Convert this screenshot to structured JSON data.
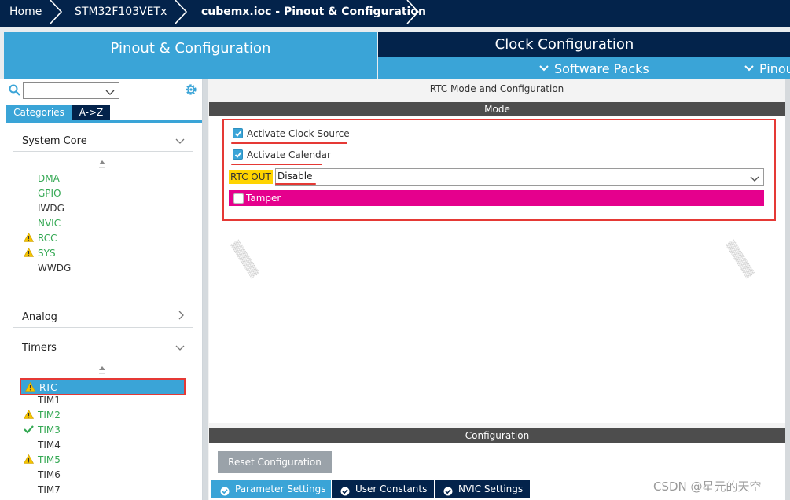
{
  "breadcrumb": {
    "items": [
      {
        "label": "Home"
      },
      {
        "label": "STM32F103VETx"
      },
      {
        "label": "cubemx.ioc - Pinout & Configuration"
      }
    ]
  },
  "main_tabs": {
    "pinout": "Pinout & Configuration",
    "clock": "Clock Configuration"
  },
  "sub_tabs": {
    "software_packs": "Software Packs",
    "pinout": "Pinout"
  },
  "sidebar": {
    "search": {
      "value": "",
      "placeholder": ""
    },
    "tabs": {
      "categories": "Categories",
      "az": "A->Z"
    },
    "groups": {
      "system_core": {
        "label": "System Core",
        "items": [
          {
            "label": "DMA",
            "status": "none",
            "configured": true
          },
          {
            "label": "GPIO",
            "status": "none",
            "configured": true
          },
          {
            "label": "IWDG",
            "status": "none",
            "configured": false
          },
          {
            "label": "NVIC",
            "status": "none",
            "configured": true
          },
          {
            "label": "RCC",
            "status": "warning",
            "configured": true
          },
          {
            "label": "SYS",
            "status": "warning",
            "configured": true
          },
          {
            "label": "WWDG",
            "status": "none",
            "configured": false
          }
        ]
      },
      "analog": {
        "label": "Analog"
      },
      "timers": {
        "label": "Timers",
        "items": [
          {
            "label": "RTC",
            "status": "warning",
            "selected": true
          },
          {
            "label": "TIM1",
            "status": "none",
            "configured": false
          },
          {
            "label": "TIM2",
            "status": "warning",
            "configured": true
          },
          {
            "label": "TIM3",
            "status": "ok",
            "configured": true
          },
          {
            "label": "TIM4",
            "status": "none",
            "configured": false
          },
          {
            "label": "TIM5",
            "status": "warning",
            "configured": true
          },
          {
            "label": "TIM6",
            "status": "none",
            "configured": false
          },
          {
            "label": "TIM7",
            "status": "none",
            "configured": false
          }
        ]
      }
    }
  },
  "mode_panel": {
    "title": "RTC Mode and Configuration",
    "section": "Mode",
    "activate_clock_source": {
      "label": "Activate Clock Source",
      "checked": true
    },
    "activate_calendar": {
      "label": "Activate Calendar",
      "checked": true
    },
    "rtc_out": {
      "label": "RTC OUT",
      "value": "Disable"
    },
    "tamper": {
      "label": "Tamper",
      "checked": false
    }
  },
  "config_panel": {
    "section": "Configuration",
    "reset_button": "Reset Configuration",
    "tabs": [
      {
        "label": "Parameter Settings",
        "active": true
      },
      {
        "label": "User Constants",
        "active": false
      },
      {
        "label": "NVIC Settings",
        "active": false
      }
    ]
  },
  "watermark_text": "CSDN @星元的天空",
  "colors": {
    "navy": "#03234b",
    "accent_blue": "#3aa4d7",
    "green_configured": "#34a853",
    "warning_yellow": "#ffd400",
    "tamper_magenta": "#e5008d",
    "highlight_red": "#e53935"
  }
}
